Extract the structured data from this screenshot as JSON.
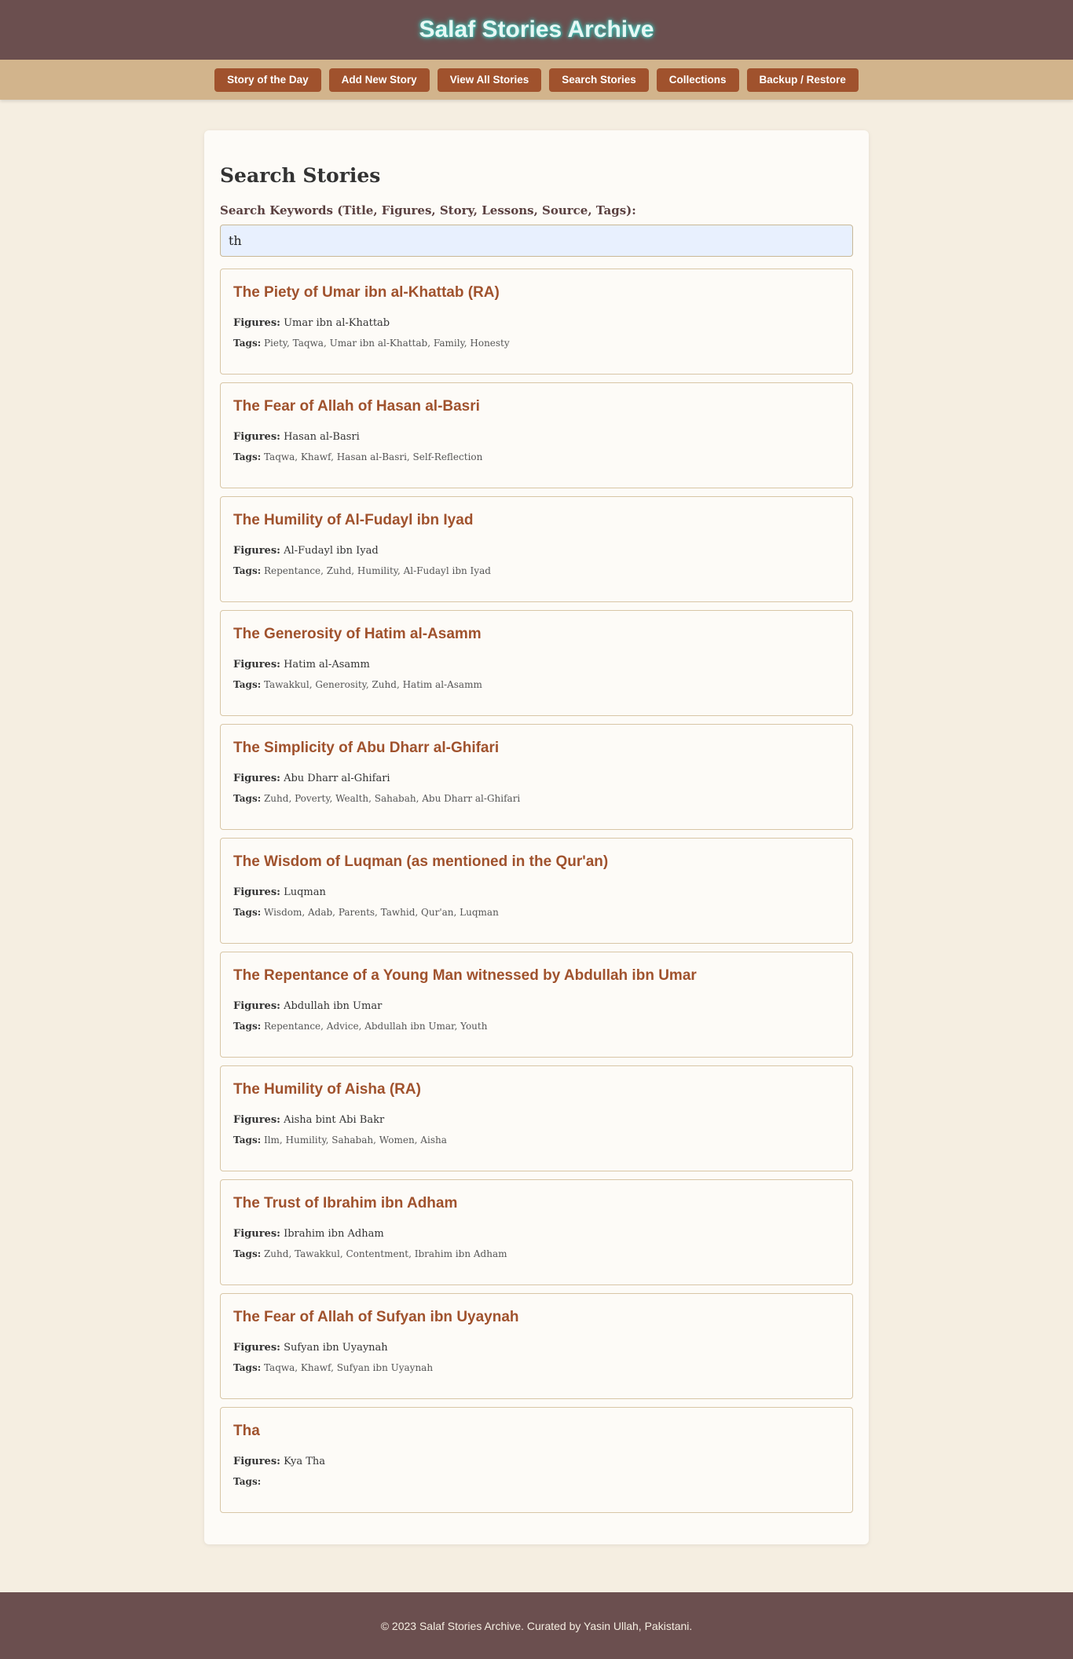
{
  "header": {
    "title": "Salaf Stories Archive"
  },
  "nav": {
    "items": [
      {
        "label": "Story of the Day"
      },
      {
        "label": "Add New Story"
      },
      {
        "label": "View All Stories"
      },
      {
        "label": "Search Stories"
      },
      {
        "label": "Collections"
      },
      {
        "label": "Backup / Restore"
      }
    ]
  },
  "search": {
    "title": "Search Stories",
    "label": "Search Keywords (Title, Figures, Story, Lessons, Source, Tags):",
    "value": "th",
    "figures_label": "Figures:",
    "tags_label": "Tags:"
  },
  "results": [
    {
      "title": "The Piety of Umar ibn al-Khattab (RA)",
      "figures": "Umar ibn al-Khattab",
      "tags": "Piety, Taqwa, Umar ibn al-Khattab, Family, Honesty"
    },
    {
      "title": "The Fear of Allah of Hasan al-Basri",
      "figures": "Hasan al-Basri",
      "tags": "Taqwa, Khawf, Hasan al-Basri, Self-Reflection"
    },
    {
      "title": "The Humility of Al-Fudayl ibn Iyad",
      "figures": "Al-Fudayl ibn Iyad",
      "tags": "Repentance, Zuhd, Humility, Al-Fudayl ibn Iyad"
    },
    {
      "title": "The Generosity of Hatim al-Asamm",
      "figures": "Hatim al-Asamm",
      "tags": "Tawakkul, Generosity, Zuhd, Hatim al-Asamm"
    },
    {
      "title": "The Simplicity of Abu Dharr al-Ghifari",
      "figures": "Abu Dharr al-Ghifari",
      "tags": "Zuhd, Poverty, Wealth, Sahabah, Abu Dharr al-Ghifari"
    },
    {
      "title": "The Wisdom of Luqman (as mentioned in the Qur'an)",
      "figures": "Luqman",
      "tags": "Wisdom, Adab, Parents, Tawhid, Qur'an, Luqman"
    },
    {
      "title": "The Repentance of a Young Man witnessed by Abdullah ibn Umar",
      "figures": "Abdullah ibn Umar",
      "tags": "Repentance, Advice, Abdullah ibn Umar, Youth"
    },
    {
      "title": "The Humility of Aisha (RA)",
      "figures": "Aisha bint Abi Bakr",
      "tags": "Ilm, Humility, Sahabah, Women, Aisha"
    },
    {
      "title": "The Trust of Ibrahim ibn Adham",
      "figures": "Ibrahim ibn Adham",
      "tags": "Zuhd, Tawakkul, Contentment, Ibrahim ibn Adham"
    },
    {
      "title": "The Fear of Allah of Sufyan ibn Uyaynah",
      "figures": "Sufyan ibn Uyaynah",
      "tags": "Taqwa, Khawf, Sufyan ibn Uyaynah"
    },
    {
      "title": "Tha",
      "figures": "Kya Tha",
      "tags": ""
    }
  ],
  "footer": {
    "text": "© 2023 Salaf Stories Archive. Curated by Yasin Ullah, Pakistani."
  },
  "colors": {
    "header_bg": "#6b4f4f",
    "nav_bg": "#d2b48c",
    "button_bg": "#a0522d",
    "accent_title": "#a0522d",
    "page_bg": "#f5eee1"
  }
}
